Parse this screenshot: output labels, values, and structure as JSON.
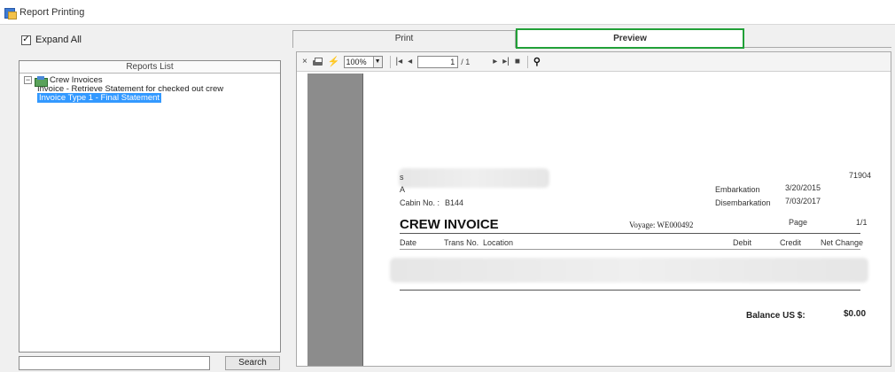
{
  "window": {
    "title": "Report Printing"
  },
  "left": {
    "expand_all_label": "Expand All",
    "expand_all_checked": "✓",
    "reports_list_header": "Reports List",
    "tree": {
      "root_label": "Crew Invoices",
      "expander": "−",
      "children": [
        "Invoice - Retrieve Statement for checked out crew",
        "Invoice Type 1 - Final Statement"
      ]
    },
    "search_placeholder": "",
    "search_button": "Search"
  },
  "tabs": {
    "print": "Print",
    "preview": "Preview"
  },
  "toolbar": {
    "close": "×",
    "zoom": "100%",
    "first": "|◂",
    "prev": "◂",
    "page": "1",
    "page_total": "/ 1",
    "next": "▸",
    "last": "▸|",
    "stop": "■"
  },
  "document": {
    "invoice_number": "71904",
    "cabin_label": "Cabin No. :",
    "cabin_value": "B144",
    "embarkation_label": "Embarkation",
    "embarkation_value": "3/20/2015",
    "disembarkation_label": "Disembarkation",
    "disembarkation_value": "7/03/2017",
    "title": "CREW INVOICE",
    "voyage": "Voyage: WE000492",
    "page_label": "Page",
    "page_value": "1/1",
    "columns": [
      "Date",
      "Trans No.",
      "Location",
      "Debit",
      "Credit",
      "Net Change"
    ],
    "balance_label": "Balance US $:",
    "balance_value": "$0.00"
  }
}
